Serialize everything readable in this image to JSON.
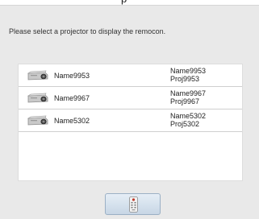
{
  "header": {
    "partial_text": "p"
  },
  "prompt_text": "Please select a projector to display the remocon.",
  "projectors": [
    {
      "name": "Name9953",
      "info_name": "Name9953",
      "info_proj": "Proj9953",
      "icon": "projector-icon"
    },
    {
      "name": "Name9967",
      "info_name": "Name9967",
      "info_proj": "Proj9967",
      "icon": "projector-icon"
    },
    {
      "name": "Name5302",
      "info_name": "Name5302",
      "info_proj": "Proj5302",
      "icon": "projector-icon"
    }
  ],
  "remocon_button": {
    "icon": "remote-control-icon"
  },
  "colors": {
    "panel_bg": "#e9e9e9",
    "list_bg": "#ffffff",
    "button_border": "#9bb0c5"
  }
}
